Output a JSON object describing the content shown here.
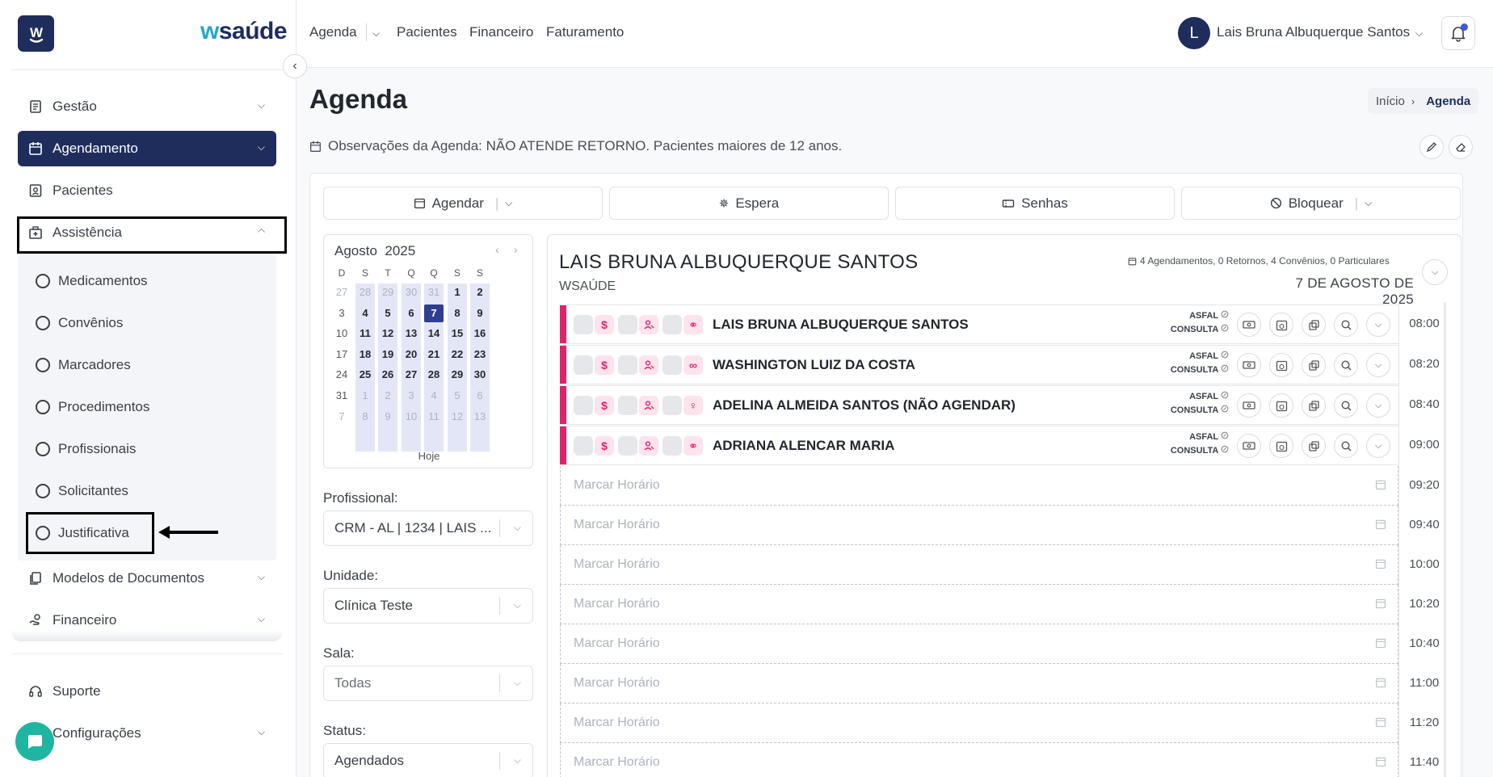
{
  "brand": {
    "logo_letter": "W",
    "name_w": "w",
    "name_rest": "saúde",
    "color": "#1f2d5c",
    "accent": "#26a8c9"
  },
  "sidebar": {
    "items": [
      {
        "label": "Gestão",
        "icon": "ledger-icon"
      },
      {
        "label": "Agendamento",
        "icon": "calendar-icon",
        "active": true
      },
      {
        "label": "Pacientes",
        "icon": "id-card-icon"
      },
      {
        "label": "Assistência",
        "icon": "hospital-icon",
        "expanded": true
      },
      {
        "label": "Modelos de Documentos",
        "icon": "documents-icon"
      },
      {
        "label": "Financeiro",
        "icon": "hand-money-icon"
      }
    ],
    "submenu": [
      "Medicamentos",
      "Convênios",
      "Marcadores",
      "Procedimentos",
      "Profissionais",
      "Solicitantes",
      "Justificativa"
    ],
    "bottom": [
      {
        "label": "Suporte",
        "icon": "headset-icon"
      },
      {
        "label": "Configurações",
        "icon": "gear-icon"
      }
    ]
  },
  "topnav": {
    "agenda": "Agenda",
    "pacientes": "Pacientes",
    "financeiro": "Financeiro",
    "faturamento": "Faturamento"
  },
  "user": {
    "initial": "L",
    "name": "Lais Bruna Albuquerque Santos"
  },
  "page": {
    "title": "Agenda",
    "breadcrumb": {
      "home": "Início",
      "current": "Agenda"
    },
    "observation": "Observações da Agenda: NÃO ATENDE RETORNO. Pacientes maiores de 12 anos."
  },
  "actions": {
    "agendar": "Agendar",
    "espera": "Espera",
    "senhas": "Senhas",
    "bloquear": "Bloquear"
  },
  "calendar": {
    "month": "Agosto",
    "year": "2025",
    "weekdays": [
      "D",
      "S",
      "T",
      "Q",
      "Q",
      "S",
      "S"
    ],
    "weeks": [
      [
        "27",
        "28",
        "29",
        "30",
        "31",
        "1",
        "2"
      ],
      [
        "3",
        "4",
        "5",
        "6",
        "7",
        "8",
        "9"
      ],
      [
        "10",
        "11",
        "12",
        "13",
        "14",
        "15",
        "16"
      ],
      [
        "17",
        "18",
        "19",
        "20",
        "21",
        "22",
        "23"
      ],
      [
        "24",
        "25",
        "26",
        "27",
        "28",
        "29",
        "30"
      ],
      [
        "31",
        "1",
        "2",
        "3",
        "4",
        "5",
        "6"
      ],
      [
        "7",
        "8",
        "9",
        "10",
        "11",
        "12",
        "13"
      ]
    ],
    "selected_day": "7",
    "today_label": "Hoje"
  },
  "filters": {
    "profissional_label": "Profissional:",
    "profissional_value": "CRM - AL | 1234 | LAIS ...",
    "unidade_label": "Unidade:",
    "unidade_value": "Clínica Teste",
    "sala_label": "Sala:",
    "sala_value": "Todas",
    "status_label": "Status:",
    "status_value": "Agendados"
  },
  "schedule": {
    "doctor": "LAIS BRUNA ALBUQUERQUE SANTOS",
    "unit": "WSAÚDE",
    "stats": "4 Agendamentos, 0 Retornos, 4 Convênios, 0 Particulares",
    "date": "7 DE AGOSTO DE 2025",
    "appointments": [
      {
        "patient": "LAIS BRUNA ALBUQUERQUE SANTOS",
        "insurance": "ASFAL",
        "type": "CONSULTA",
        "time": "08:00",
        "last_icon": "glasses-icon",
        "last_glyph": "⚭"
      },
      {
        "patient": "WASHINGTON LUIZ DA COSTA",
        "insurance": "ASFAL",
        "type": "CONSULTA",
        "time": "08:20",
        "last_icon": "infinity-icon",
        "last_glyph": "∞"
      },
      {
        "patient": "ADELINA ALMEIDA SANTOS (NÃO AGENDAR)",
        "insurance": "ASFAL",
        "type": "CONSULTA",
        "time": "08:40",
        "last_icon": "female-icon",
        "last_glyph": "♀"
      },
      {
        "patient": "ADRIANA ALENCAR MARIA",
        "insurance": "ASFAL",
        "type": "CONSULTA",
        "time": "09:00",
        "last_icon": "glasses-icon",
        "last_glyph": "⚭"
      }
    ],
    "empty_label": "Marcar Horário",
    "empty_times": [
      "09:20",
      "09:40",
      "10:00",
      "10:20",
      "10:40",
      "11:00",
      "11:20",
      "11:40"
    ]
  },
  "colors": {
    "navy": "#1f2d5c",
    "pink": "#e0226e",
    "teal": "#1fb5a0"
  }
}
